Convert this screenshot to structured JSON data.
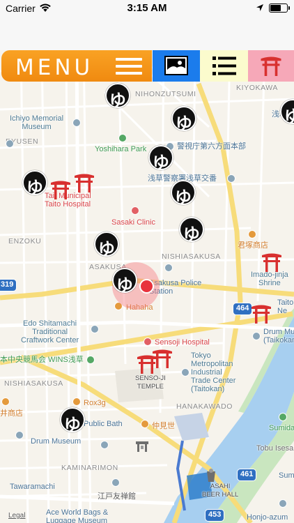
{
  "status_bar": {
    "carrier": "Carrier",
    "time": "3:15 AM"
  },
  "toolbar": {
    "menu_label": "MENU",
    "buttons": [
      "photo-icon",
      "list-icon",
      "torii-gate-icon"
    ],
    "colors": {
      "menu": "#f39416",
      "photo": "#1b7cec",
      "list": "#fbfbcd",
      "torii": "#f6a8b8"
    }
  },
  "map": {
    "districts": {
      "kiyokawa": "KIYOKAWA",
      "nihonzutsumi": "NIHONZUTSUMI",
      "ryusen": "RYUSEN",
      "nishiasakusa_n": "NISHIASAKUSA",
      "senzoku": "ENZOKU",
      "asakusa": "ASAKUSA",
      "nishiasakusa_s": "NISHIASAKUSA",
      "hanakawado": "HANAKAWADO",
      "kaminarimon": "KAMINARIMON"
    },
    "pois": {
      "ichiyo_museum": "Ichiyo Memorial\nMuseum",
      "yoshihara_park": "Yoshihara Park",
      "police_hq": "警視庁第六方面本部",
      "koban": "浅草警察署浅草交番",
      "hospital": "Tait Municipal\nTaito Hospital",
      "sasaki": "Sasaki Clinic",
      "kimizuka": "君塚商店",
      "police_station": "Asakusa Police\nStation",
      "hahaha": "Hahaha",
      "imado": "Imado-jinja\nShrine",
      "taito_edge": "Taito\nNe",
      "edo": "Edo Shitamachi\nTraditional\nCraftwork Center",
      "sensoji_hospital": "Sensoji Hospital",
      "drum_taikokan": "Drum Museum\n(Taikokan)",
      "wins": "本中央競馬会 WINS浅草",
      "tokyo_metro": "Tokyo\nMetropolitan\nIndustrial\nTrade Center\n(Taitokan)",
      "temple": "SENSO-JI\nTEMPLE",
      "rox": "Rox3g",
      "public_bath": "Public Bath",
      "nakamise": "仲見世",
      "ishoten": "井商店",
      "sumida": "Sumida P",
      "drum_museum": "Drum Museum",
      "tobu": "Tobu Isesaki",
      "tawaramachi": "Tawaramachi",
      "edo_yuzen": "江戸友禅館",
      "beer_hall": "ASAHI\nBEER HALL",
      "ace": "Ace World Bags &\nLuggage Museum",
      "honjo": "Honjo-azum",
      "sumida_top": "Sumid",
      "asakusa_edge": "浅草警"
    },
    "shields": [
      "319",
      "464",
      "461",
      "453"
    ],
    "legal": "Legal",
    "user_location_color": "#e8333d"
  },
  "markers": {
    "bathhouse_glyph": "ゆ",
    "bathhouse_count": 13,
    "shrine_count": 5
  }
}
